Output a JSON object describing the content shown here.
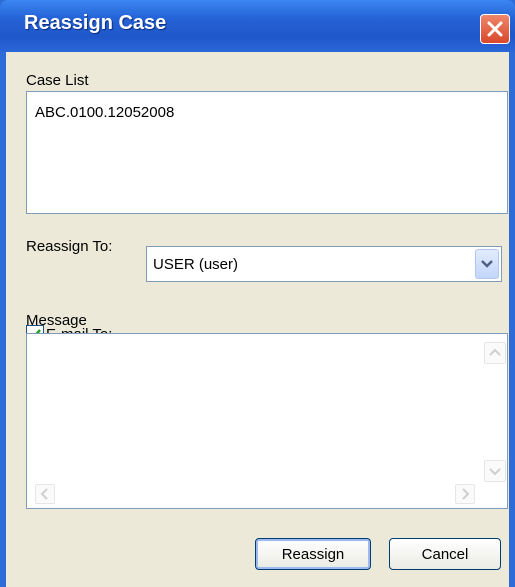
{
  "window": {
    "title": "Reassign Case"
  },
  "case_list": {
    "label": "Case List",
    "items": [
      "ABC.0100.12052008"
    ]
  },
  "reassign_to": {
    "label": "Reassign To:",
    "selected": "USER (user)"
  },
  "email_to": {
    "label": "E-mail To:",
    "checked": true
  },
  "message": {
    "label": "Message",
    "value": ""
  },
  "buttons": {
    "reassign": "Reassign",
    "cancel": "Cancel"
  }
}
